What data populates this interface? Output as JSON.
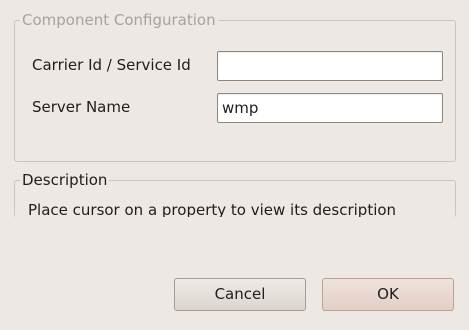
{
  "config_group": {
    "legend": "Component Configuration",
    "fields": [
      {
        "label": "Carrier Id / Service Id",
        "value": ""
      },
      {
        "label": "Server Name",
        "value": "wmp"
      }
    ]
  },
  "description_group": {
    "legend": "Description",
    "text": "Place cursor on a property to view its description"
  },
  "buttons": {
    "cancel_label": "Cancel",
    "ok_label": "OK"
  },
  "colors": {
    "background": "#ede8e3",
    "disabled_text": "#a8a29c",
    "ok_button": "#e3cfc6"
  }
}
